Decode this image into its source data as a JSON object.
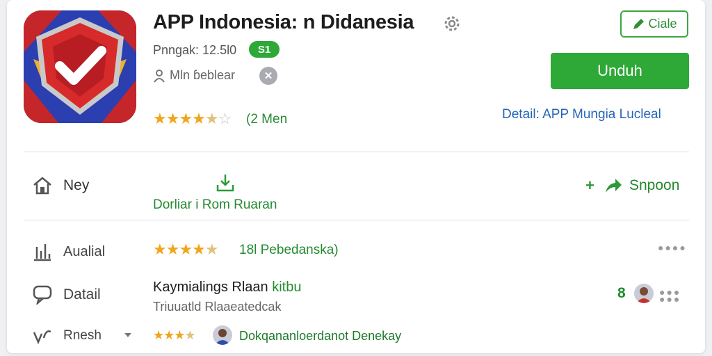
{
  "app": {
    "title": "APP Indonesia: n Didanesia",
    "meta_line1": "Pnngak: 12.5l0",
    "badge": "S1",
    "meta_line2": "Mln ɓeblear",
    "rating_text": "(2 Men",
    "rating_value": 4.5
  },
  "actions": {
    "outline_label": "Ciale",
    "primary_label": "Unduh",
    "detail_link": "Detail: APP Mungia Lucleal"
  },
  "row1": {
    "left_label": "Ney",
    "center_label": "Dorliar i Rom Ruaran",
    "right_label": "Snpoon"
  },
  "list": [
    {
      "label": "Aualial",
      "rating_text": "18l Pebedanska)",
      "rating_value": 4.5
    },
    {
      "label": "Datail",
      "title": "Kaymialings Rlaan",
      "title_tag": "kitbu",
      "subtitle": "Triuuatld Rlaaeatedcak",
      "count": "8"
    },
    {
      "label": "Rnesh",
      "status_text": "Dokqananloerdanot Denekay",
      "rating_value": 3.5
    }
  ],
  "colors": {
    "accent_green": "#2ea836",
    "link_blue": "#2565b8",
    "star": "#f0a51c"
  },
  "icons": [
    "shield-check-icon",
    "gear-icon",
    "person-icon",
    "close-icon",
    "pencil-icon",
    "home-icon",
    "download-icon",
    "plus-icon",
    "share-arrow-icon",
    "stats-icon",
    "chat-icon",
    "code-icon",
    "chevron-down-icon",
    "more-icon"
  ]
}
